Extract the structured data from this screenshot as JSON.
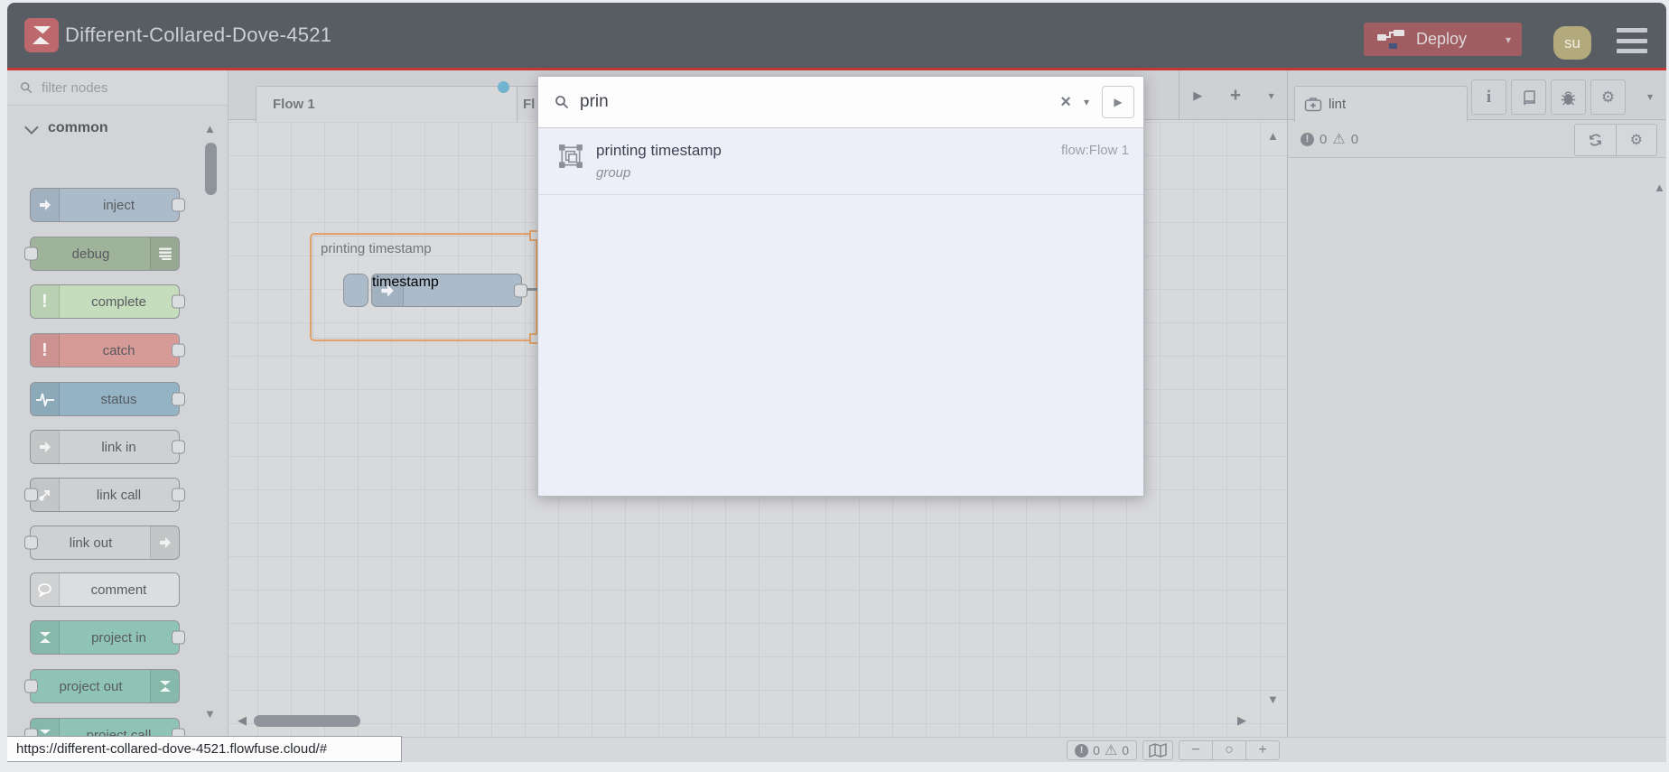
{
  "window": {
    "url_preview": "https://different-collared-dove-4521.flowfuse.cloud/#"
  },
  "header": {
    "title": "Different-Collared-Dove-4521",
    "deploy_label": "Deploy",
    "avatar": "su",
    "colors": {
      "header_bg": "#585d64",
      "accent_red": "#c53734",
      "deploy_bg": "#a15e62",
      "avatar_bg": "#b2a97d"
    }
  },
  "palette": {
    "filter_placeholder": "filter nodes",
    "category": "common",
    "nodes": [
      {
        "label": "inject",
        "color": "#abbbca",
        "icon": "inject-arrow-icon",
        "icon_side": "left",
        "ports": [
          "out"
        ]
      },
      {
        "label": "debug",
        "color": "#9fb29a",
        "icon": "debug-lines-icon",
        "icon_side": "right",
        "ports": [
          "in"
        ]
      },
      {
        "label": "complete",
        "color": "#c5dcbd",
        "icon": "exclamation-icon",
        "icon_side": "left",
        "ports": [
          "out"
        ]
      },
      {
        "label": "catch",
        "color": "#d69a97",
        "icon": "exclamation-icon",
        "icon_side": "left",
        "ports": [
          "out"
        ]
      },
      {
        "label": "status",
        "color": "#94b3c4",
        "icon": "heartbeat-icon",
        "icon_side": "left",
        "ports": [
          "out"
        ]
      },
      {
        "label": "link in",
        "color": "#cfd0d2",
        "icon": "link-arrow-icon",
        "icon_side": "left",
        "ports": [
          "out"
        ]
      },
      {
        "label": "link call",
        "color": "#cfd0d2",
        "icon": "link-call-icon",
        "icon_side": "left",
        "ports": [
          "in",
          "out"
        ]
      },
      {
        "label": "link out",
        "color": "#cfd0d2",
        "icon": "link-arrow-icon",
        "icon_side": "right",
        "ports": [
          "in"
        ]
      },
      {
        "label": "comment",
        "color": "#dcdddf",
        "icon": "comment-bubble-icon",
        "icon_side": "left",
        "ports": []
      },
      {
        "label": "project in",
        "color": "#8fc3b5",
        "icon": "project-logo-icon",
        "icon_side": "left",
        "ports": [
          "out"
        ]
      },
      {
        "label": "project out",
        "color": "#8fc3b5",
        "icon": "project-logo-icon",
        "icon_side": "right",
        "ports": [
          "in"
        ]
      },
      {
        "label": "project call",
        "color": "#8fc3b5",
        "icon": "project-logo-icon",
        "icon_side": "left",
        "ports": [
          "in",
          "out"
        ]
      }
    ]
  },
  "canvas": {
    "tabs": [
      {
        "label": "Flow 1",
        "active": true,
        "modified": true
      },
      {
        "label": "Fl",
        "active": false
      }
    ],
    "group": {
      "label": "printing timestamp",
      "node_label": "timestamp"
    }
  },
  "search": {
    "query": "prin",
    "results": [
      {
        "title": "printing timestamp",
        "subtitle": "group",
        "location": "flow:Flow 1"
      }
    ]
  },
  "sidebar": {
    "tab_label": "lint",
    "error_count": "0",
    "warning_count": "0"
  },
  "footer": {
    "error_count": "0",
    "warning_count": "0"
  }
}
